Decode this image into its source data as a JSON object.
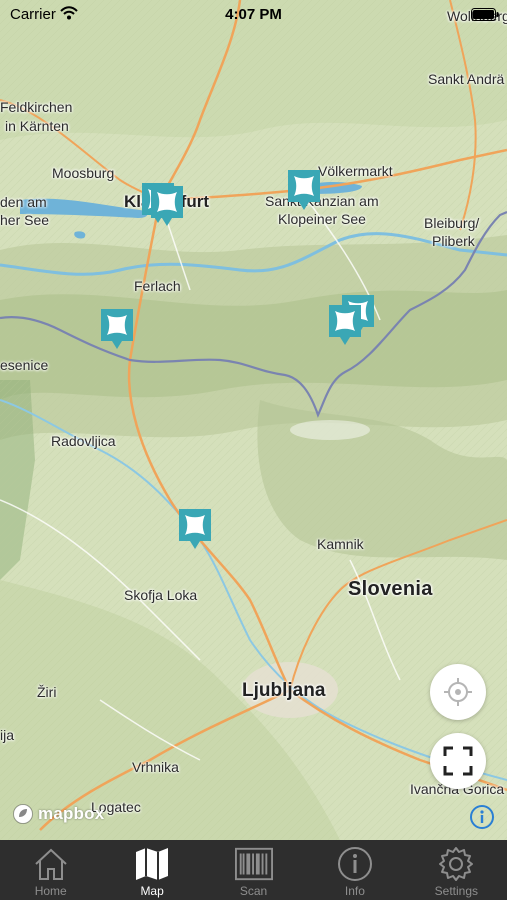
{
  "status_bar": {
    "carrier": "Carrier",
    "time": "4:07 PM"
  },
  "map": {
    "place_labels": [
      {
        "text": "Wolfsberg"
      },
      {
        "text": "Sankt Andrä"
      },
      {
        "text": "Feldkirchen"
      },
      {
        "text": "in Kärnten"
      },
      {
        "text": "Moosburg"
      },
      {
        "text": "Völkermarkt"
      },
      {
        "text": "Klagenfurt"
      },
      {
        "text": "Sankt Kanzian am"
      },
      {
        "text": "Klopeiner See"
      },
      {
        "text": "den am"
      },
      {
        "text": "her See"
      },
      {
        "text": "Bleiburg/"
      },
      {
        "text": "Pliberk"
      },
      {
        "text": "Ferlach"
      },
      {
        "text": "esenice"
      },
      {
        "text": "Radovljica"
      },
      {
        "text": "Kamnik"
      },
      {
        "text": "Slovenia"
      },
      {
        "text": "Skofja Loka"
      },
      {
        "text": "Žiri"
      },
      {
        "text": "Ljubljana"
      },
      {
        "text": "ija"
      },
      {
        "text": "Vrhnika"
      },
      {
        "text": "Logatec"
      },
      {
        "text": "Ivančna Gorica"
      }
    ],
    "marker_color": "#3aa7b5",
    "mapbox_logo_text": "mapbox"
  },
  "controls": {
    "locate_icon": "crosshair-icon",
    "fullscreen_icon": "fullscreen-icon",
    "attribution_icon": "info-icon"
  },
  "tab_bar": {
    "items": [
      {
        "label": "Home",
        "icon": "home-icon"
      },
      {
        "label": "Map",
        "icon": "map-icon",
        "active": true
      },
      {
        "label": "Scan",
        "icon": "barcode-icon"
      },
      {
        "label": "Info",
        "icon": "info-icon"
      },
      {
        "label": "Settings",
        "icon": "gear-icon"
      }
    ]
  }
}
